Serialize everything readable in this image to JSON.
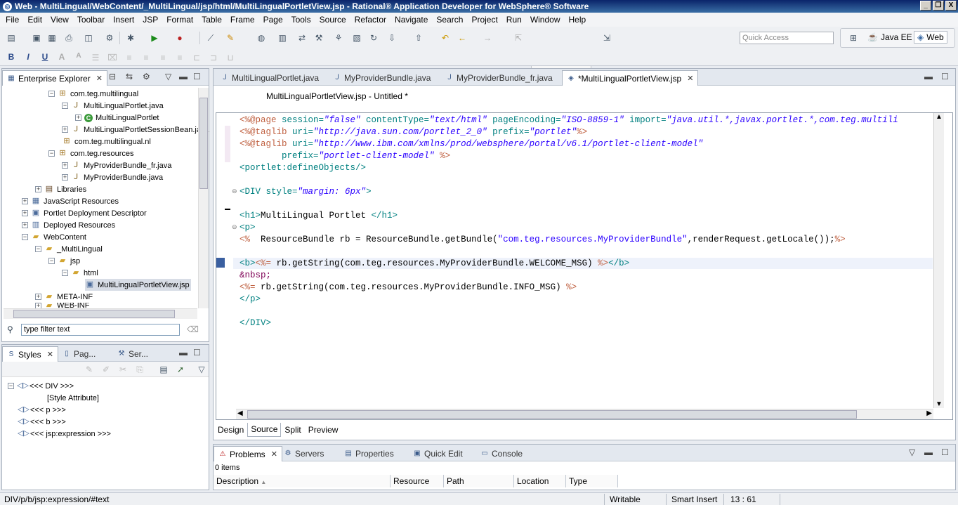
{
  "window": {
    "title": "Web - MultiLingual/WebContent/_MultiLingual/jsp/html/MultiLingualPortletView.jsp - Rational® Application Developer for WebSphere® Software",
    "minimize": "_",
    "restore": "❐",
    "close": "X"
  },
  "menu": [
    "File",
    "Edit",
    "View",
    "Toolbar",
    "Insert",
    "JSP",
    "Format",
    "Table",
    "Frame",
    "Page",
    "Tools",
    "Source",
    "Refactor",
    "Navigate",
    "Search",
    "Project",
    "Run",
    "Window",
    "Help"
  ],
  "toolbar": {
    "quick_access_placeholder": "Quick Access",
    "perspectives": [
      "Java EE",
      "Web"
    ],
    "format_buttons": [
      "B",
      "I",
      "U",
      "A",
      "A"
    ]
  },
  "explorer": {
    "title": "Enterprise Explorer",
    "tree": [
      {
        "label": "com.teg.multilingual",
        "icon": "package-icon"
      },
      {
        "label": "MultiLingualPortlet.java",
        "icon": "java-file-icon"
      },
      {
        "label": "MultiLingualPortlet",
        "icon": "class-icon"
      },
      {
        "label": "MultiLingualPortletSessionBean.java",
        "icon": "java-file-icon"
      },
      {
        "label": "com.teg.multilingual.nl",
        "icon": "package-icon"
      },
      {
        "label": "com.teg.resources",
        "icon": "package-icon"
      },
      {
        "label": "MyProviderBundle_fr.java",
        "icon": "java-file-icon"
      },
      {
        "label": "MyProviderBundle.java",
        "icon": "java-file-icon"
      },
      {
        "label": "Libraries",
        "icon": "library-icon"
      },
      {
        "label": "JavaScript Resources",
        "icon": "javascript-icon"
      },
      {
        "label": "Portlet Deployment Descriptor",
        "icon": "descriptor-icon"
      },
      {
        "label": "Deployed Resources",
        "icon": "deployed-icon"
      },
      {
        "label": "WebContent",
        "icon": "folder-icon"
      },
      {
        "label": "_MultiLingual",
        "icon": "folder-icon"
      },
      {
        "label": "jsp",
        "icon": "folder-icon"
      },
      {
        "label": "html",
        "icon": "folder-icon"
      },
      {
        "label": "MultiLingualPortletView.jsp",
        "icon": "jsp-file-icon"
      },
      {
        "label": "META-INF",
        "icon": "folder-icon"
      },
      {
        "label": "WEB-INF",
        "icon": "folder-icon"
      }
    ],
    "filter_value": "type filter text"
  },
  "styles_panel": {
    "tabs": [
      "Styles",
      "Pag...",
      "Ser..."
    ],
    "tree": [
      {
        "label": "<<< DIV >>>"
      },
      {
        "label": "[Style Attribute]"
      },
      {
        "label": "<<< p >>>"
      },
      {
        "label": "<<< b >>>"
      },
      {
        "label": "<<< jsp:expression >>>"
      }
    ]
  },
  "editor": {
    "tabs": [
      {
        "label": "MultiLingualPortlet.java"
      },
      {
        "label": "MyProviderBundle.java"
      },
      {
        "label": "MyProviderBundle_fr.java"
      },
      {
        "label": "*MultiLingualPortletView.jsp"
      }
    ],
    "subtitle": "MultiLingualPortletView.jsp - Untitled *",
    "code": {
      "l1_a": "<%@page ",
      "l1_b": "session=",
      "l1_c": "\"false\"",
      "l1_d": " contentType=",
      "l1_e": "\"text/html\"",
      "l1_f": " pageEncoding=",
      "l1_g": "\"ISO-8859-1\"",
      "l1_h": " import=",
      "l1_i": "\"java.util.*,javax.portlet.*,com.teg.multili",
      "l2_a": "<%@taglib ",
      "l2_b": "uri=",
      "l2_c": "\"http://java.sun.com/portlet_2_0\"",
      "l2_d": " prefix=",
      "l2_e": "\"portlet\"",
      "l2_f": "%>",
      "l3_a": "<%@taglib ",
      "l3_b": "uri=",
      "l3_c": "\"http://www.ibm.com/xmlns/prod/websphere/portal/v6.1/portlet-client-model\"",
      "l4_a": "        prefix=",
      "l4_b": "\"portlet-client-model\"",
      "l4_c": " %>",
      "l5": "<portlet:defineObjects/>",
      "l6_a": "<DIV ",
      "l6_b": "style=",
      "l6_c": "\"margin: 6px\"",
      "l6_d": ">",
      "l7_a": "<h1>",
      "l7_b": "MultiLingual Portlet ",
      "l7_c": "</h1>",
      "l8": "<p>",
      "l9_a": "<% ",
      "l9_b": " ResourceBundle rb = ResourceBundle.getBundle(",
      "l9_c": "\"com.teg.resources.MyProviderBundle\"",
      "l9_d": ",renderRequest.getLocale());",
      "l9_e": "%>",
      "l10_a": "<b>",
      "l10_b": "<%=",
      "l10_c": " rb.getString(com.teg.resources.MyProviderBundle.WELCOME_MSG) ",
      "l10_d": "%>",
      "l10_e": "</b>",
      "l11": "&nbsp;",
      "l12_a": "<%=",
      "l12_b": " rb.getString(com.teg.resources.MyProviderBundle.INFO_MSG) ",
      "l12_c": "%>",
      "l13": "</p>",
      "l14": "</DIV>"
    },
    "bottom_tabs": [
      "Design",
      "Source",
      "Split",
      "Preview"
    ]
  },
  "problems": {
    "tabs": [
      "Problems",
      "Servers",
      "Properties",
      "Quick Edit",
      "Console"
    ],
    "count": "0 items",
    "columns": [
      "Description",
      "Resource",
      "Path",
      "Location",
      "Type"
    ]
  },
  "status": {
    "path": "DIV/p/b/jsp:expression/#text",
    "writable": "Writable",
    "insert_mode": "Smart Insert",
    "position": "13 : 61"
  }
}
